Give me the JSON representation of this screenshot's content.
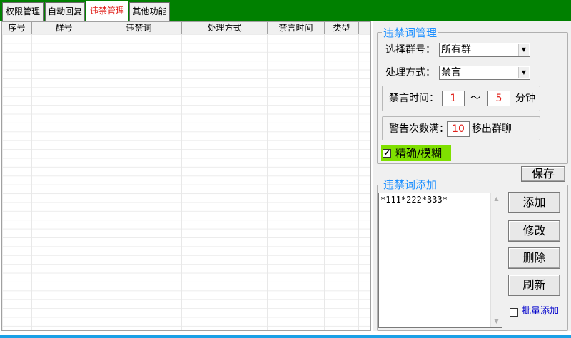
{
  "tabs": [
    {
      "label": "权限管理",
      "active": false
    },
    {
      "label": "自动回复",
      "active": false
    },
    {
      "label": "违禁管理",
      "active": true
    },
    {
      "label": "其他功能",
      "active": false
    }
  ],
  "table": {
    "columns": [
      "序号",
      "群号",
      "违禁词",
      "处理方式",
      "禁言时间",
      "类型"
    ],
    "rows": []
  },
  "ban_words_manage": {
    "title": "违禁词管理",
    "group_label": "选择群号：",
    "group_value": "所有群",
    "action_label": "处理方式：",
    "action_value": "禁言",
    "mute_time_label": "禁言时间：",
    "mute_min": "1",
    "mute_sep": "～",
    "mute_max": "5",
    "mute_unit": "分钟",
    "warn_label": "警告次数满：",
    "warn_count": "10",
    "warn_suffix": "移出群聊",
    "match_label": "精确/模糊",
    "match_checked": true,
    "save_label": "保存"
  },
  "ban_words_add": {
    "title": "违禁词添加",
    "text": "*111*222*333*",
    "add_label": "添加",
    "edit_label": "修改",
    "delete_label": "删除",
    "refresh_label": "刷新",
    "batch_label": "批量添加",
    "batch_checked": false
  },
  "colors": {
    "tab_bar": "#008000",
    "active_tab_text": "#e0201a",
    "group_title": "#1e90ff",
    "match_bg": "#7fe000",
    "value_red": "#e0201a",
    "batch_text": "#0000cc",
    "bottom_line": "#1aa0e6"
  }
}
